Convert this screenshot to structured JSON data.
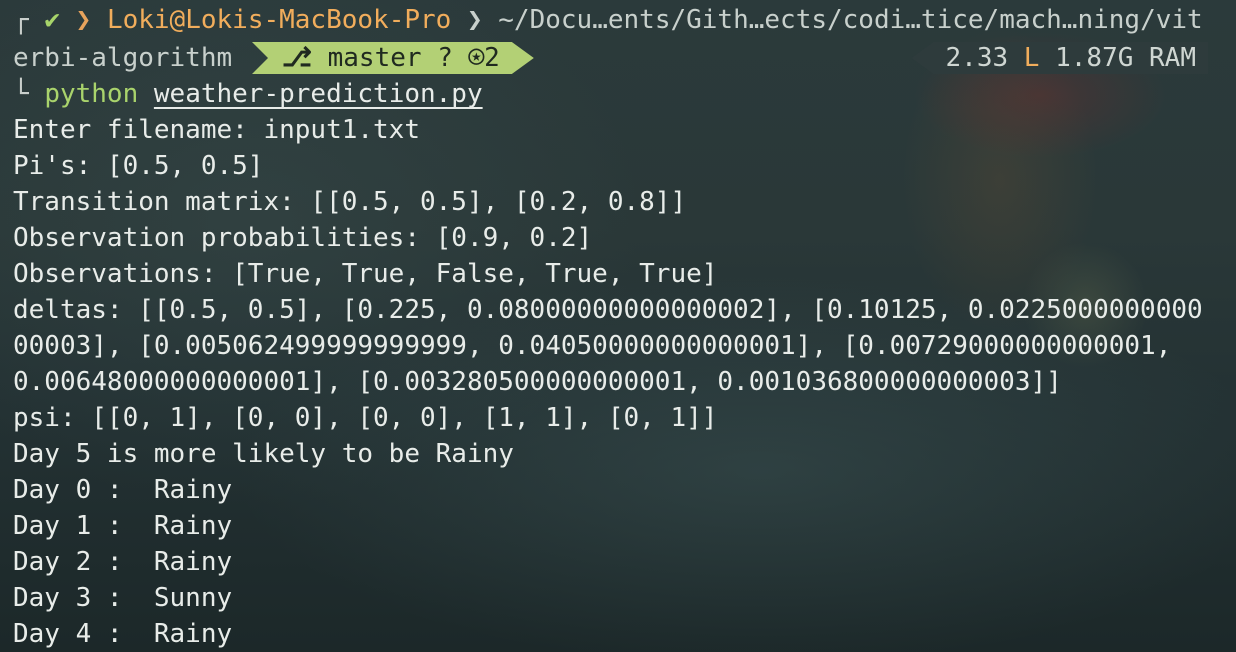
{
  "prompt": {
    "top_corner": "┌",
    "status_icon": "✔",
    "separator": "❯",
    "user_host": "Loki@Lokis-MacBook-Pro",
    "path_line1": "~/Docu…ents/Gith…ects/codi…tice/mach…ning/vit",
    "path_line2": "erbi-algorithm",
    "git": {
      "branch": "master",
      "status": "? ⍟2"
    },
    "resources": {
      "load": "2.33",
      "load_label": "L",
      "ram": "1.87G RAM"
    },
    "bottom_corner": "└",
    "command": "python",
    "argument": "weather-prediction.py"
  },
  "output_lines": [
    "Enter filename: input1.txt",
    "Pi's: [0.5, 0.5]",
    "Transition matrix: [[0.5, 0.5], [0.2, 0.8]]",
    "Observation probabilities: [0.9, 0.2]",
    "Observations: [True, True, False, True, True]",
    "deltas: [[0.5, 0.5], [0.225, 0.08000000000000002], [0.10125, 0.0225000000000",
    "00003], [0.005062499999999999, 0.04050000000000001], [0.00729000000000001,",
    "0.00648000000000001], [0.003280500000000001, 0.001036800000000003]]",
    "psi: [[0, 1], [0, 0], [0, 0], [1, 1], [0, 1]]",
    "Day 5 is more likely to be Rainy",
    "Day 0 :  Rainy",
    "Day 1 :  Rainy",
    "Day 2 :  Rainy",
    "Day 3 :  Sunny",
    "Day 4 :  Rainy"
  ]
}
